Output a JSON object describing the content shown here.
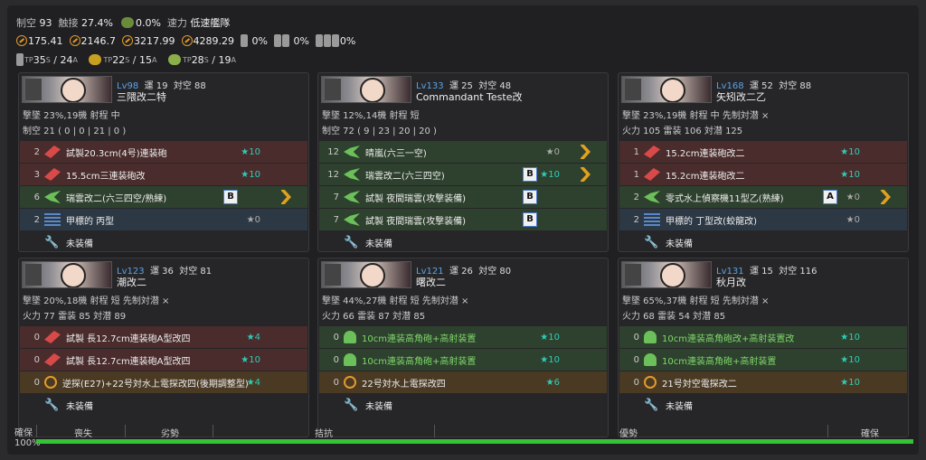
{
  "summary": {
    "air_superiority_label": "制空",
    "air_superiority": "93",
    "contact_label": "触接",
    "contact": "27.4%",
    "aa_label": "0.0%",
    "speed_label": "速力",
    "speed": "低速艦隊",
    "los": [
      "175.41",
      "2146.7",
      "3217.99",
      "4289.29"
    ],
    "drum": "0%",
    "landing": "0%",
    "landing2": "0%",
    "tp_label": "TP",
    "tp1": "35",
    "tp1s": "S",
    "tp2": "24",
    "tp2s": "A",
    "tp3": "22",
    "tp3s": "S",
    "tp4": "15",
    "tp4s": "A",
    "tp5": "28",
    "tp5s": "S",
    "tp6": "19",
    "tp6s": "A"
  },
  "ships": [
    {
      "lv": "Lv98",
      "luck": "運 19",
      "aa": "対空 88",
      "name": "三隈改二特",
      "l1": "撃墜 23%,19機  射程 中",
      "l2": "制空 21 ( 0 | 0 | 21 | 0 )",
      "slots": [
        {
          "c": "red",
          "cnt": "2",
          "ic": "red",
          "name": "試製20.3cm(4号)連装砲",
          "star": "★10",
          "sg": false
        },
        {
          "c": "red",
          "cnt": "3",
          "ic": "red",
          "name": "15.5cm三連装砲改",
          "star": "★10",
          "sg": false
        },
        {
          "c": "green",
          "cnt": "6",
          "ic": "greenp",
          "name": "瑞雲改二(六三四空/熟練)",
          "star": "",
          "box": "B",
          "prof": true
        },
        {
          "c": "blue",
          "cnt": "2",
          "ic": "blue",
          "name": "甲標的 丙型",
          "star": "★0",
          "sg": true
        },
        {
          "c": "none",
          "cnt": "",
          "ic": "wrench",
          "name": "未装備",
          "star": ""
        }
      ]
    },
    {
      "lv": "Lv133",
      "luck": "運 25",
      "aa": "対空 48",
      "name": "Commandant Teste改",
      "l1": "撃墜 12%,14機  射程 短",
      "l2": "制空 72 ( 9 | 23 | 20 | 20 )",
      "slots": [
        {
          "c": "green",
          "cnt": "12",
          "ic": "greenp",
          "name": "晴嵐(六三一空)",
          "star": "★0",
          "sg": true,
          "prof": true
        },
        {
          "c": "green",
          "cnt": "12",
          "ic": "greenp",
          "name": "瑞雲改二(六三四空)",
          "star": "★10",
          "box": "B",
          "prof": true
        },
        {
          "c": "green",
          "cnt": "7",
          "ic": "greenp",
          "name": "試製 夜間瑞雲(攻撃装備)",
          "star": "",
          "box": "B"
        },
        {
          "c": "green",
          "cnt": "7",
          "ic": "greenp",
          "name": "試製 夜間瑞雲(攻撃装備)",
          "star": "",
          "box": "B"
        },
        {
          "c": "none",
          "cnt": "",
          "ic": "wrench",
          "name": "未装備",
          "star": ""
        }
      ]
    },
    {
      "lv": "Lv168",
      "luck": "運 52",
      "aa": "対空 88",
      "name": "矢矧改二乙",
      "l1": "撃墜 23%,19機  射程 中  先制対潜 ×",
      "l2": "火力 105  雷装 106  対潜 125",
      "slots": [
        {
          "c": "red",
          "cnt": "1",
          "ic": "red",
          "name": "15.2cm連装砲改二",
          "star": "★10"
        },
        {
          "c": "red",
          "cnt": "1",
          "ic": "red",
          "name": "15.2cm連装砲改二",
          "star": "★10"
        },
        {
          "c": "green",
          "cnt": "2",
          "ic": "greenp",
          "name": "零式水上偵察機11型乙(熟練)",
          "star": "★0",
          "sg": true,
          "box": "A",
          "prof": true
        },
        {
          "c": "blue",
          "cnt": "2",
          "ic": "blue",
          "name": "甲標的 丁型改(蛟龍改)",
          "star": "★0",
          "sg": true
        },
        {
          "c": "none",
          "cnt": "",
          "ic": "wrench",
          "name": "未装備",
          "star": ""
        }
      ]
    },
    {
      "lv": "Lv123",
      "luck": "運 36",
      "aa": "対空 81",
      "name": "潮改二",
      "l1": "撃墜 20%,18機  射程 短  先制対潜 ×",
      "l2": "火力 77  雷装 85  対潜 89",
      "slots": [
        {
          "c": "red",
          "cnt": "0",
          "ic": "red",
          "name": "試製 長12.7cm連装砲A型改四",
          "star": "★4"
        },
        {
          "c": "red",
          "cnt": "0",
          "ic": "red",
          "name": "試製 長12.7cm連装砲A型改四",
          "star": "★10"
        },
        {
          "c": "orange",
          "cnt": "0",
          "ic": "orange",
          "name": "逆探(E27)+22号対水上電探改四(後期調整型)",
          "star": "★4"
        },
        {
          "c": "none",
          "cnt": "",
          "ic": "wrench",
          "name": "未装備",
          "star": ""
        }
      ]
    },
    {
      "lv": "Lv121",
      "luck": "運 26",
      "aa": "対空 80",
      "name": "曙改二",
      "l1": "撃墜 44%,27機  射程 短  先制対潜 ×",
      "l2": "火力 66  雷装 87  対潜 85",
      "slots": [
        {
          "c": "green",
          "cnt": "0",
          "ic": "aa",
          "name": "10cm連装高角砲+高射装置",
          "star": "★10",
          "g": true
        },
        {
          "c": "green",
          "cnt": "0",
          "ic": "aa",
          "name": "10cm連装高角砲+高射装置",
          "star": "★10",
          "g": true
        },
        {
          "c": "orange",
          "cnt": "0",
          "ic": "orange",
          "name": "22号対水上電探改四",
          "star": "★6"
        },
        {
          "c": "none",
          "cnt": "",
          "ic": "wrench",
          "name": "未装備",
          "star": ""
        }
      ]
    },
    {
      "lv": "Lv131",
      "luck": "運 15",
      "aa": "対空 116",
      "name": "秋月改",
      "l1": "撃墜 65%,37機  射程 短  先制対潜 ×",
      "l2": "火力 68  雷装 54  対潜 85",
      "slots": [
        {
          "c": "green",
          "cnt": "0",
          "ic": "aa",
          "name": "10cm連装高角砲改+高射装置改",
          "star": "★10",
          "g": true
        },
        {
          "c": "green",
          "cnt": "0",
          "ic": "aa",
          "name": "10cm連装高角砲+高射装置",
          "star": "★10",
          "g": true
        },
        {
          "c": "orange",
          "cnt": "0",
          "ic": "orange",
          "name": "21号対空電探改二",
          "star": "★10"
        },
        {
          "c": "none",
          "cnt": "",
          "ic": "wrench",
          "name": "未装備",
          "star": ""
        }
      ]
    }
  ],
  "bar": {
    "pct": "100%",
    "side": "確保",
    "labels": [
      "喪失",
      "劣勢",
      "拮抗",
      "優勢",
      "確保"
    ]
  }
}
